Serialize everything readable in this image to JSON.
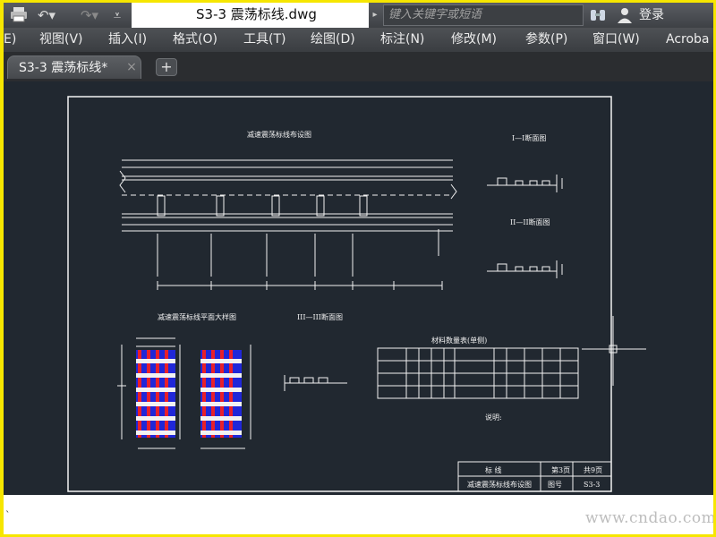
{
  "titlebar": {
    "document_title": "S3-3 震荡标线.dwg",
    "search_placeholder": "键入关键字或短语",
    "login_label": "登录"
  },
  "menubar": {
    "items": [
      "E)",
      "视图(V)",
      "插入(I)",
      "格式(O)",
      "工具(T)",
      "绘图(D)",
      "标注(N)",
      "修改(M)",
      "参数(P)",
      "窗口(W)",
      "Acroba"
    ]
  },
  "tabs": {
    "active_label": "S3-3 震荡标线*",
    "close_glyph": "×",
    "add_glyph": "+"
  },
  "drawing": {
    "plan_title": "减速震荡标线布设图",
    "detail_title": "减速震荡标线平面大样图",
    "section_1": "I—I断面图",
    "section_2": "II—II断面图",
    "section_3": "III—III断面图",
    "table_title": "材料数量表(单侧)",
    "notes_title": "说明:",
    "title_block": {
      "project": "标 线",
      "page_label": "第3页",
      "total_label": "共9页",
      "drawing_name": "减速震荡标线布设图",
      "number_label": "图号",
      "number": "S3-3"
    }
  },
  "colors": {
    "canvas_bg": "#212830",
    "line": "#f2f2f2",
    "stripe_red": "#e8202a",
    "stripe_blue": "#2027d8"
  },
  "commandline": {
    "prompt": "`"
  },
  "watermark": "www.cndao.com"
}
